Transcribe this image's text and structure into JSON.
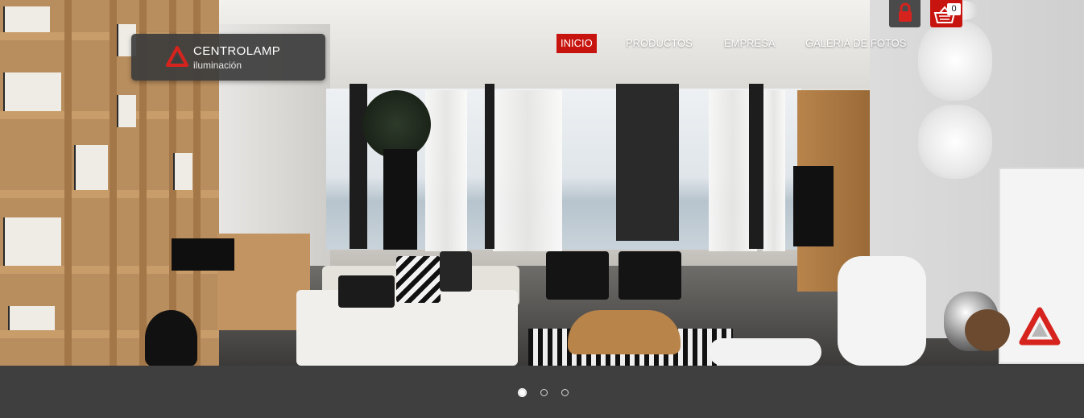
{
  "brand": {
    "name": "CENTROLAMP",
    "tagline": "iluminación",
    "accent_color": "#c8140f"
  },
  "nav": {
    "items": [
      {
        "label": "INICIO",
        "active": true
      },
      {
        "label": "PRODUCTOS",
        "active": false
      },
      {
        "label": "EMPRESA",
        "active": false
      },
      {
        "label": "GALERIA DE FOTOS",
        "active": false
      }
    ]
  },
  "toolbar": {
    "lock_icon": "lock-icon",
    "cart_icon": "shopping-basket-icon",
    "cart_count": "0"
  },
  "slider": {
    "total_slides": 3,
    "active_slide": 1
  }
}
